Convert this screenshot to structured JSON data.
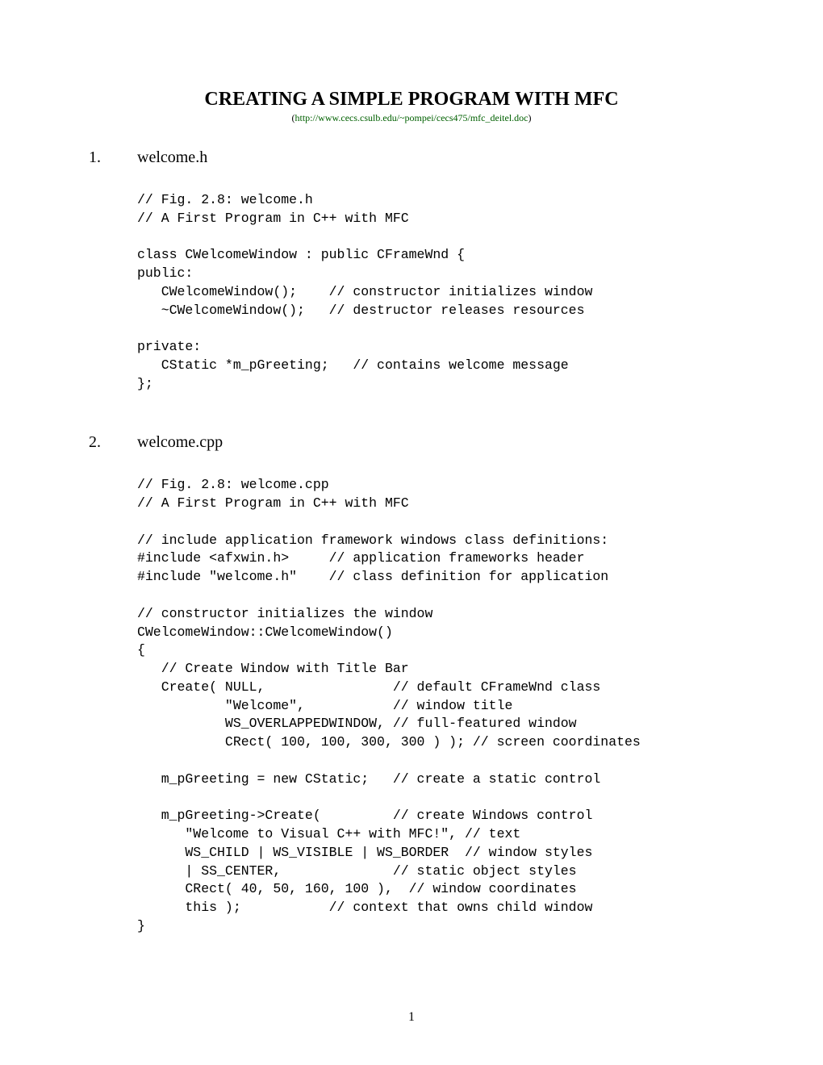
{
  "title": "CREATING A SIMPLE PROGRAM WITH MFC",
  "subtitle": {
    "open": "(",
    "link": "http://www.cecs.csulb.edu/~pompei/cecs475/mfc_deitel.doc",
    "close": ")"
  },
  "sections": [
    {
      "number": "1.",
      "title": "welcome.h",
      "code": "// Fig. 2.8: welcome.h\n// A First Program in C++ with MFC\n\nclass CWelcomeWindow : public CFrameWnd {\npublic:\n   CWelcomeWindow();    // constructor initializes window\n   ~CWelcomeWindow();   // destructor releases resources\n\nprivate:\n   CStatic *m_pGreeting;   // contains welcome message\n};"
    },
    {
      "number": "2.",
      "title": "welcome.cpp",
      "code": "// Fig. 2.8: welcome.cpp\n// A First Program in C++ with MFC\n\n// include application framework windows class definitions:\n#include <afxwin.h>     // application frameworks header\n#include \"welcome.h\"    // class definition for application\n\n// constructor initializes the window\nCWelcomeWindow::CWelcomeWindow()\n{\n   // Create Window with Title Bar\n   Create( NULL,                // default CFrameWnd class\n           \"Welcome\",           // window title\n           WS_OVERLAPPEDWINDOW, // full-featured window\n           CRect( 100, 100, 300, 300 ) ); // screen coordinates\n\n   m_pGreeting = new CStatic;   // create a static control\n\n   m_pGreeting->Create(         // create Windows control\n      \"Welcome to Visual C++ with MFC!\", // text\n      WS_CHILD | WS_VISIBLE | WS_BORDER  // window styles\n      | SS_CENTER,              // static object styles\n      CRect( 40, 50, 160, 100 ),  // window coordinates\n      this );           // context that owns child window\n}"
    }
  ],
  "pageNumber": "1"
}
